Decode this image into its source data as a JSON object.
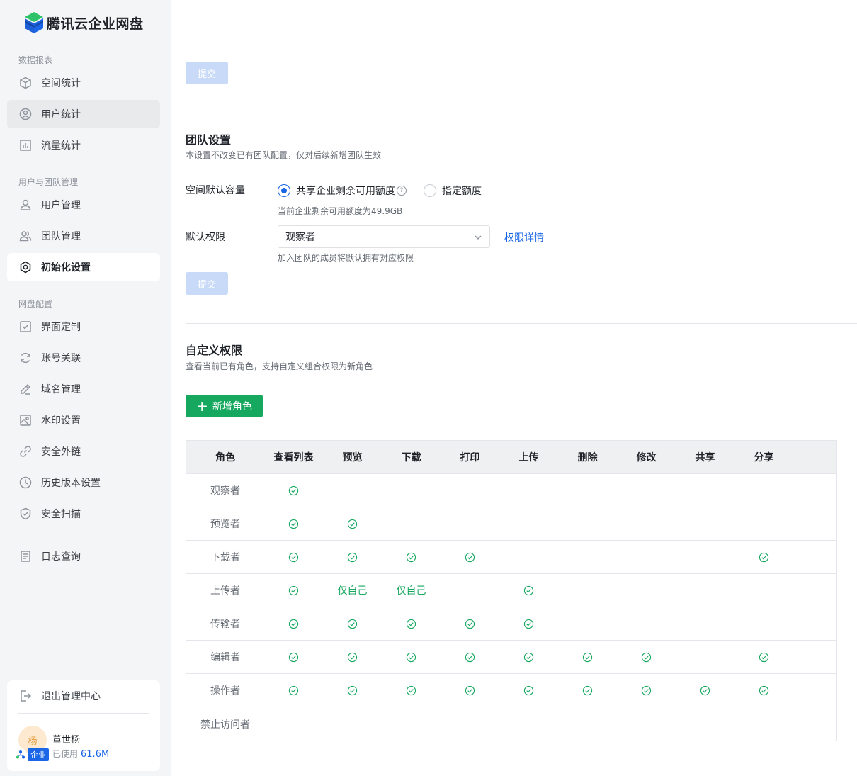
{
  "brand": {
    "name": "腾讯云企业网盘"
  },
  "sidebar": {
    "groups": [
      {
        "title": "数据报表",
        "items": [
          {
            "label": "空间统计",
            "icon": "cube-icon"
          },
          {
            "label": "用户统计",
            "icon": "user-circle-icon"
          },
          {
            "label": "流量统计",
            "icon": "bar-chart-icon"
          }
        ]
      },
      {
        "title": "用户与团队管理",
        "items": [
          {
            "label": "用户管理",
            "icon": "user-icon"
          },
          {
            "label": "团队管理",
            "icon": "team-icon"
          },
          {
            "label": "初始化设置",
            "icon": "hexagon-settings-icon"
          }
        ]
      },
      {
        "title": "网盘配置",
        "items": [
          {
            "label": "界面定制",
            "icon": "checkbox-icon"
          },
          {
            "label": "账号关联",
            "icon": "refresh-icon"
          },
          {
            "label": "域名管理",
            "icon": "pen-icon"
          },
          {
            "label": "水印设置",
            "icon": "image-icon"
          },
          {
            "label": "安全外链",
            "icon": "link-icon"
          },
          {
            "label": "历史版本设置",
            "icon": "clock-icon"
          },
          {
            "label": "安全扫描",
            "icon": "shield-icon"
          }
        ]
      }
    ],
    "log_item": {
      "label": "日志查询",
      "icon": "document-icon"
    }
  },
  "user_card": {
    "exit_label": "退出管理中心",
    "avatar_text": "杨",
    "badge": "企业",
    "name": "董世杨",
    "usage_label": "已使用",
    "usage_value": "61.6M"
  },
  "top_submit": "提交",
  "team_settings": {
    "title": "团队设置",
    "subtitle": "本设置不改变已有团队配置，仅对后续新增团队生效",
    "capacity_label": "空间默认容量",
    "capacity_options": [
      "共享企业剩余可用额度",
      "指定额度"
    ],
    "capacity_selected": 0,
    "capacity_hint": "当前企业剩余可用额度为49.9GB",
    "help_glyph": "?",
    "permission_label": "默认权限",
    "permission_value": "观察者",
    "permission_link": "权限详情",
    "permission_hint": "加入团队的成员将默认拥有对应权限",
    "submit": "提交"
  },
  "custom_permissions": {
    "title": "自定义权限",
    "subtitle": "查看当前已有角色，支持自定义组合权限为新角色",
    "add_button": "新增角色",
    "add_glyph": "+",
    "columns": [
      "角色",
      "查看列表",
      "预览",
      "下载",
      "打印",
      "上传",
      "删除",
      "修改",
      "共享",
      "分享"
    ],
    "rows": [
      {
        "role": "观察者",
        "cells": [
          "check",
          "",
          "",
          "",
          "",
          "",
          "",
          "",
          ""
        ]
      },
      {
        "role": "预览者",
        "cells": [
          "check",
          "check",
          "",
          "",
          "",
          "",
          "",
          "",
          ""
        ]
      },
      {
        "role": "下载者",
        "cells": [
          "check",
          "check",
          "check",
          "check",
          "",
          "",
          "",
          "",
          "check"
        ]
      },
      {
        "role": "上传者",
        "cells": [
          "check",
          "仅自己",
          "仅自己",
          "",
          "check",
          "",
          "",
          "",
          ""
        ]
      },
      {
        "role": "传输者",
        "cells": [
          "check",
          "check",
          "check",
          "check",
          "check",
          "",
          "",
          "",
          ""
        ]
      },
      {
        "role": "编辑者",
        "cells": [
          "check",
          "check",
          "check",
          "check",
          "check",
          "check",
          "check",
          "",
          "check"
        ]
      },
      {
        "role": "操作者",
        "cells": [
          "check",
          "check",
          "check",
          "check",
          "check",
          "check",
          "check",
          "check",
          "check"
        ]
      },
      {
        "role": "禁止访问者",
        "cells": [
          "",
          "",
          "",
          "",
          "",
          "",
          "",
          "",
          ""
        ]
      }
    ]
  },
  "colors": {
    "primary": "#1a66e6",
    "success": "#17a85f",
    "disabled": "#c9d9f8"
  }
}
